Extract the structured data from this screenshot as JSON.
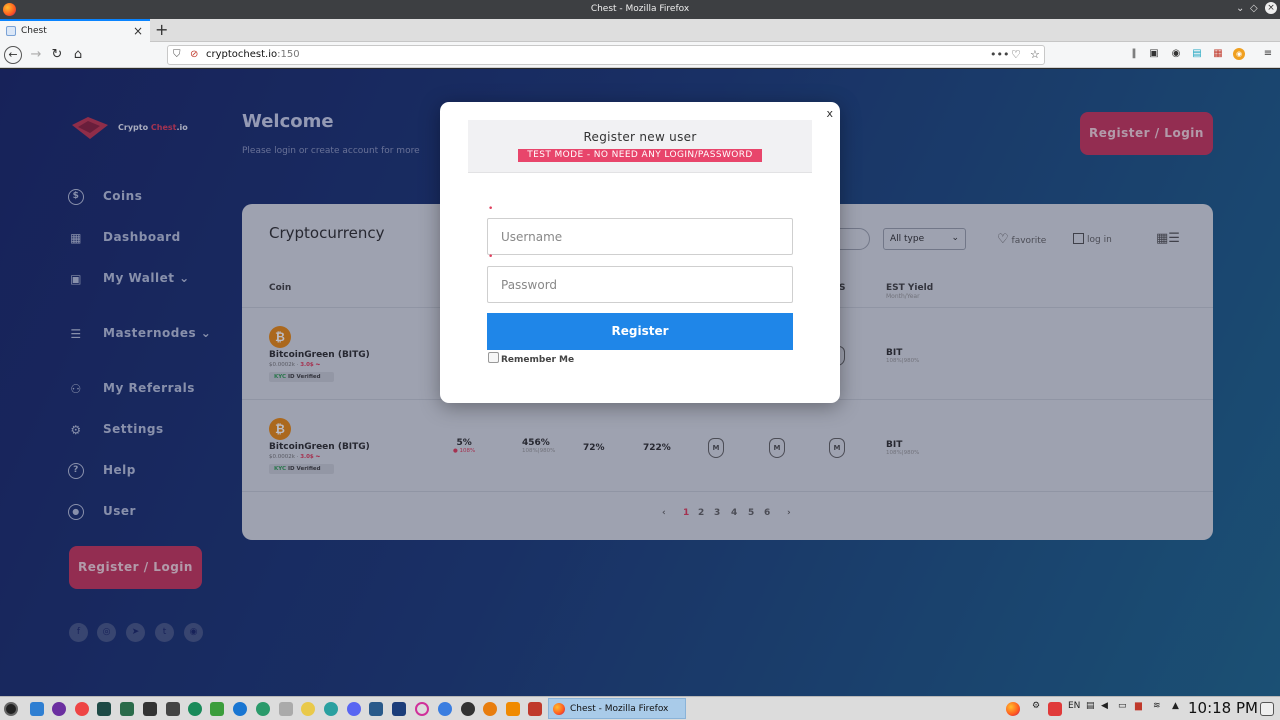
{
  "window": {
    "title": "Chest - Mozilla Firefox"
  },
  "browser": {
    "tab_label": "Chest",
    "url_host": "cryptochest.io",
    "url_port": ":150"
  },
  "sidebar": {
    "logo_a": "Crypto ",
    "logo_b": "Chest",
    "logo_c": ".io",
    "items": [
      {
        "label": "Coins",
        "icon": "dollar-circle-icon"
      },
      {
        "label": "Dashboard",
        "icon": "grid-icon"
      },
      {
        "label": "My Wallet ⌄",
        "icon": "wallet-icon"
      },
      {
        "label": "Masternodes ⌄",
        "icon": "server-icon"
      },
      {
        "label": "My Referrals",
        "icon": "users-icon"
      },
      {
        "label": "Settings",
        "icon": "gear-icon"
      },
      {
        "label": "Help",
        "icon": "question-circle-icon"
      },
      {
        "label": "User",
        "icon": "user-circle-icon"
      }
    ],
    "login_button": "Register / Login"
  },
  "header": {
    "title": "Welcome",
    "subtitle": "Please login or create account for more",
    "login_button": "Register / Login"
  },
  "panel": {
    "title": "Cryptocurrency",
    "type_select": "All type",
    "favorite": "favorite",
    "logged": "log in",
    "columns": {
      "coin": "Coin",
      "s": "S",
      "est_yield": "EST Yield",
      "est_yield_sub": "Month/Year"
    },
    "rows": [
      {
        "name": "BitcoinGreen (BITG)",
        "price": "$0.0002k",
        "change": "3.0$ ⏦",
        "kyc_a": "KYC",
        "kyc_b": " ID Verified",
        "yield": "BIT",
        "yield_sub": "108%|980%"
      },
      {
        "name": "BitcoinGreen (BITG)",
        "price": "$0.0002k",
        "change": "3.0$ ⏦",
        "kyc_a": "KYC",
        "kyc_b": " ID Verified",
        "c1": "5%",
        "c1_sub": "● 108%",
        "c2": "456%",
        "c2_sub": "108%|980%",
        "c3": "72%",
        "c4": "722%",
        "node_letter": "M",
        "yield": "BIT",
        "yield_sub": "108%|980%"
      }
    ],
    "pages": [
      "1",
      "2",
      "3",
      "4",
      "5",
      "6"
    ],
    "current_page": "1"
  },
  "modal": {
    "close": "x",
    "title": "Register new user",
    "badge": "TEST MODE - NO NEED ANY LOGIN/PASSWORD",
    "required_mark": "•",
    "username_placeholder": "Username",
    "password_placeholder": "Password",
    "register_button": "Register",
    "remember": "Remember Me"
  },
  "taskbar": {
    "task_label": "Chest - Mozilla Firefox",
    "lang": "EN",
    "time": "10:18 PM"
  },
  "colors": {
    "accent_red": "#c83a5f",
    "primary_blue": "#1f86e8",
    "badge_pink": "#e8456b",
    "bitcoin_orange": "#e98b17"
  }
}
